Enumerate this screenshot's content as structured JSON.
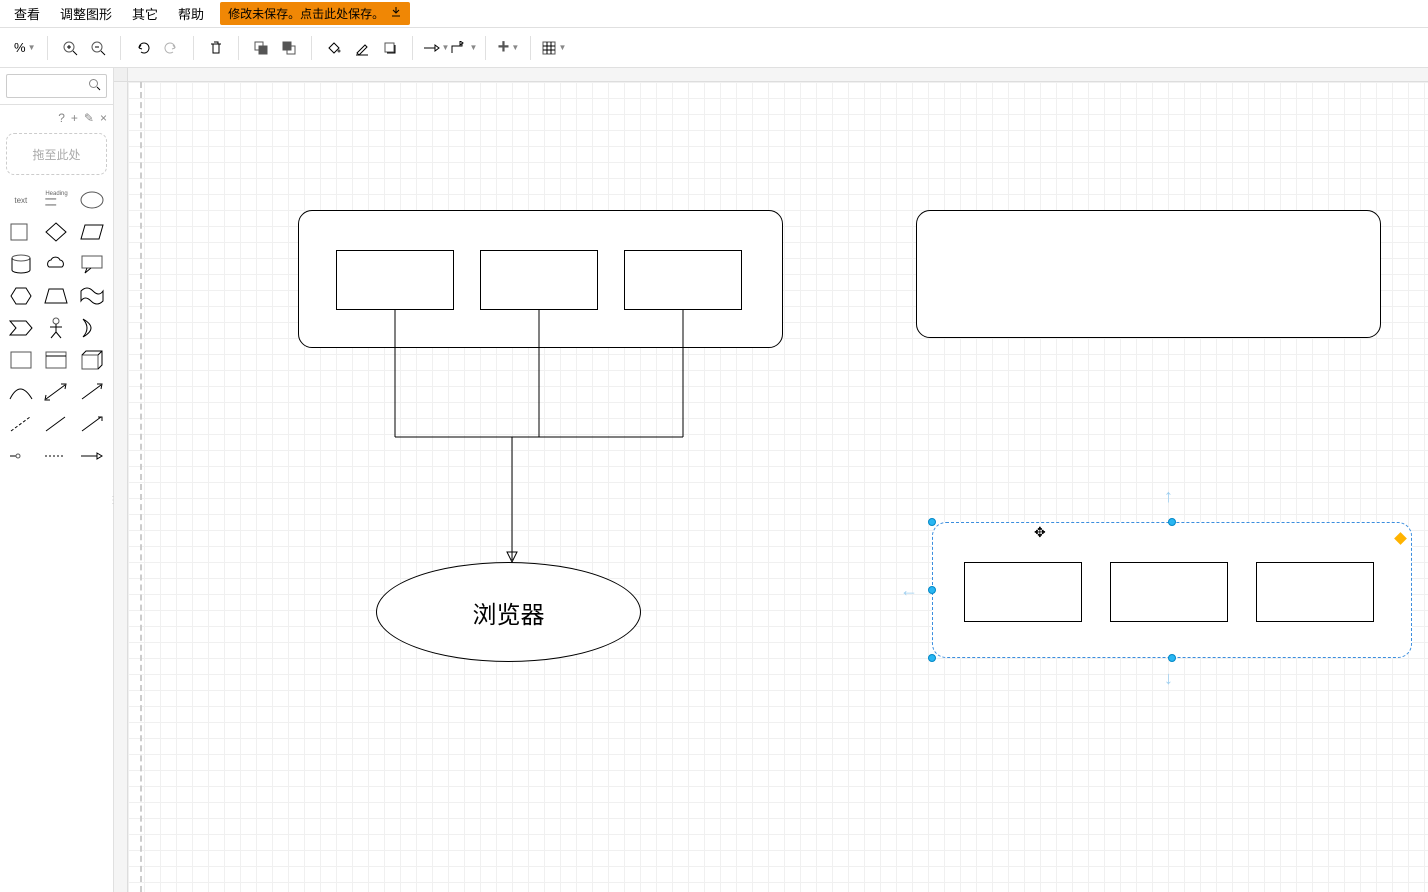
{
  "menu": {
    "view": "查看",
    "adjust": "调整图形",
    "other": "其它",
    "help": "帮助"
  },
  "save_notice": "修改未保存。点击此处保存。",
  "zoom": "%",
  "sidebar": {
    "drag_hint": "拖至此处"
  },
  "diagram": {
    "ellipse_label": "浏览器"
  }
}
